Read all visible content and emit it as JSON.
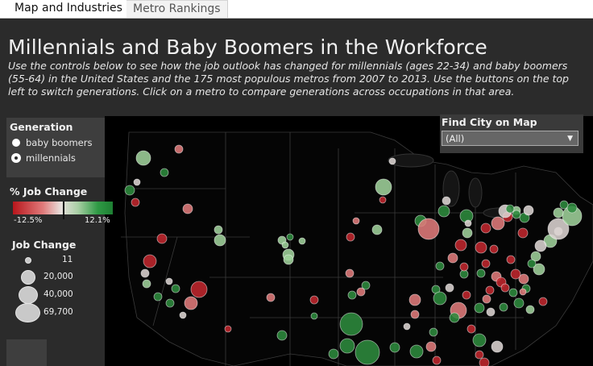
{
  "tabs": [
    {
      "label": "Map and Industries",
      "active": true
    },
    {
      "label": "Metro Rankings",
      "active": false
    }
  ],
  "title": "Millennials and Baby Boomers in the Workforce",
  "subtitle": "Use the controls below to see how the job outlook has changed for millennials (ages 22-34) and baby boomers (55-64) in the United States and the 175 most populous metros from 2007 to 2013. Use the buttons on the top left to switch generations. Click on a metro to compare generations across occupations in that area.",
  "generation": {
    "title": "Generation",
    "options": [
      {
        "label": "baby boomers",
        "selected": false
      },
      {
        "label": "millennials",
        "selected": true
      }
    ]
  },
  "pct_legend": {
    "title": "% Job Change",
    "min_label": "-12.5%",
    "max_label": "12.1%",
    "colors": {
      "negative": "#b8161c",
      "neutral": "#e8e0dd",
      "positive": "#1e7f33"
    }
  },
  "size_legend": {
    "title": "Job Change",
    "items": [
      "11",
      "20,000",
      "40,000",
      "69,700"
    ]
  },
  "find_city": {
    "title": "Find City on Map",
    "selected": "(All)"
  }
}
